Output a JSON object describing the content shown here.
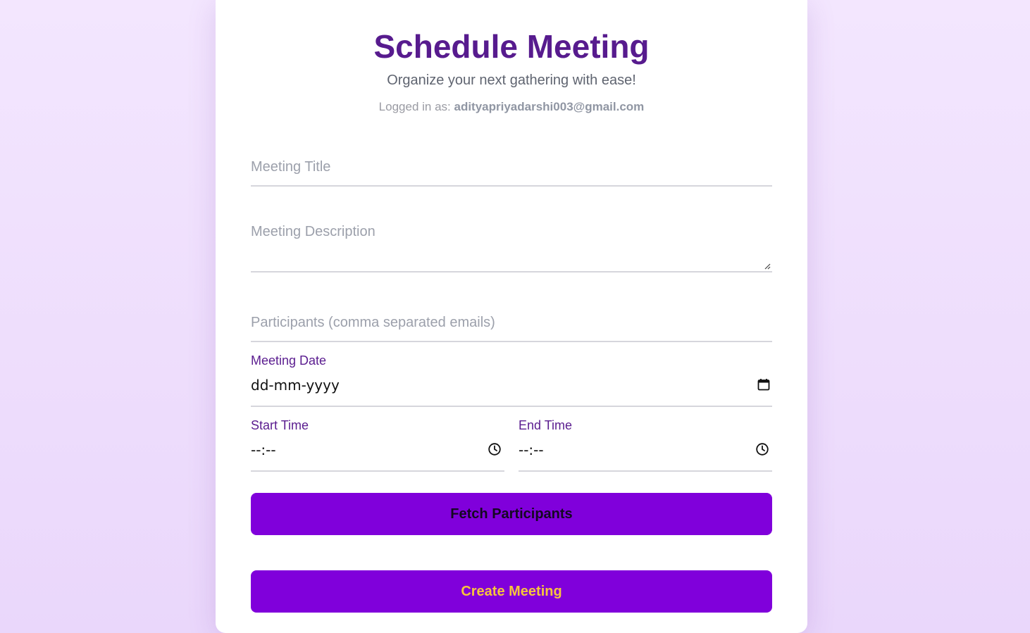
{
  "header": {
    "title": "Schedule Meeting",
    "subtitle": "Organize your next gathering with ease!",
    "logged_in_prefix": "Logged in as:",
    "logged_in_email": "adityapriyadarshi003@gmail.com"
  },
  "form": {
    "title_placeholder": "Meeting Title",
    "description_placeholder": "Meeting Description",
    "participants_placeholder": "Participants (comma separated emails)",
    "date_label": "Meeting Date",
    "date_value": "dd-mm-yyyy",
    "start_time_label": "Start Time",
    "start_time_value": "--:--",
    "end_time_label": "End Time",
    "end_time_value": "--:--"
  },
  "actions": {
    "fetch_label": "Fetch Participants",
    "create_label": "Create Meeting"
  },
  "theme": {
    "accent": "#8000db",
    "title_color": "#571b8e",
    "create_text_color": "#f7c53c",
    "background_top": "#f3e6fe",
    "background_bottom": "#ead7fb"
  },
  "icons": {
    "date": "calendar-icon",
    "time": "clock-icon",
    "textarea_resize": "resize-grip-icon"
  }
}
